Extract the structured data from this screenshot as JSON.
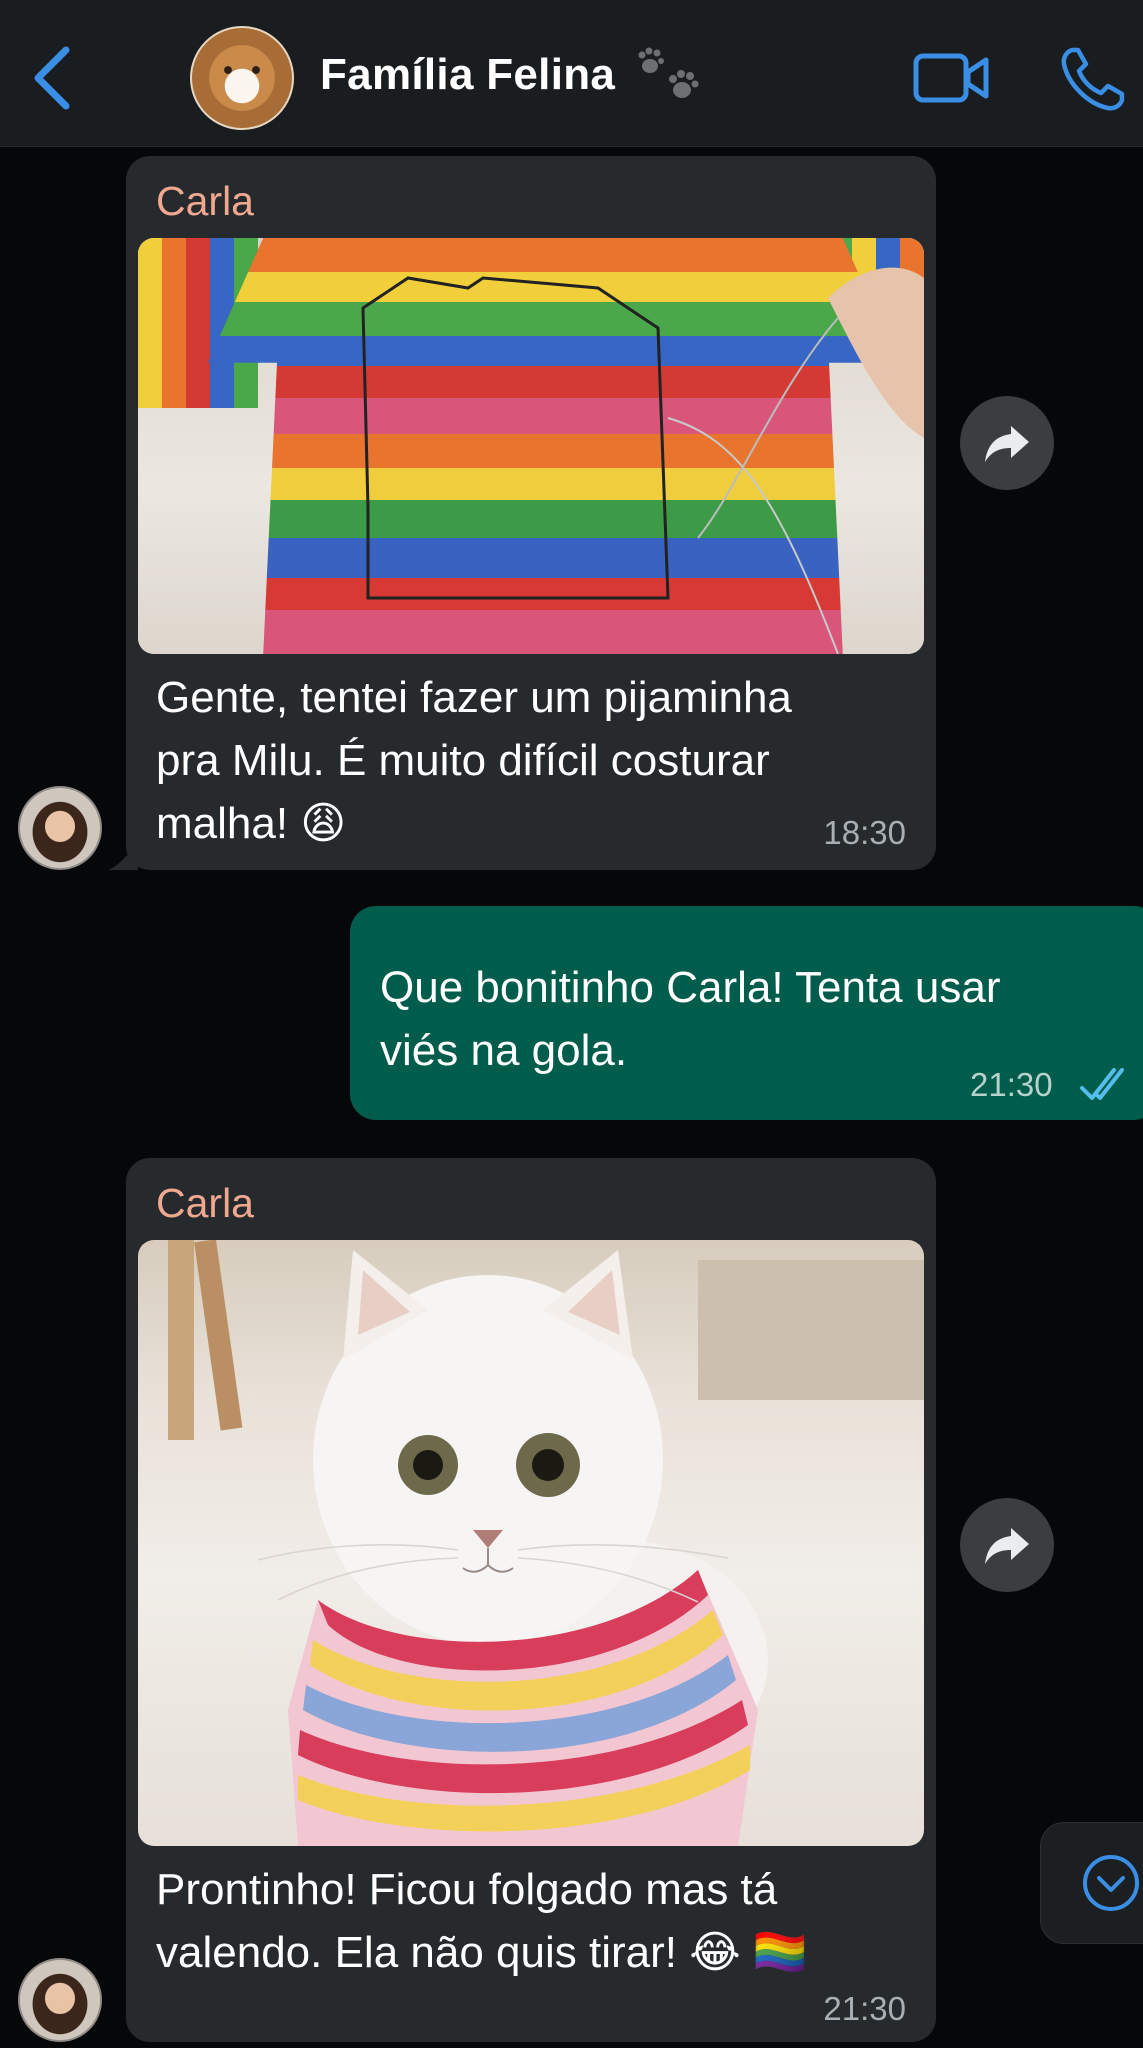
{
  "header": {
    "title": "Família Felina",
    "back_icon": "chevron-left-icon",
    "video_icon": "video-camera-icon",
    "call_icon": "phone-icon",
    "accent_color": "#3a8ee6"
  },
  "messages": [
    {
      "sender": "Carla",
      "text_lines": [
        "Gente, tentei fazer um pijaminha",
        "pra Milu. É muito difícil costurar",
        "malha! 😩"
      ],
      "time": "18:30",
      "direction": "incoming",
      "has_photo": true
    },
    {
      "text_lines": [
        "Que bonitinho Carla! Tenta usar",
        "viés na gola."
      ],
      "time": "21:30",
      "direction": "outgoing",
      "status": "read"
    },
    {
      "sender": "Carla",
      "text_lines": [
        "Prontinho! Ficou folgado mas tá",
        "valendo. Ela não quis tirar! 😂 🏳️‍🌈"
      ],
      "time": "21:30",
      "direction": "incoming",
      "has_photo": true
    }
  ],
  "colors": {
    "incoming_bubble": "#262a2c",
    "outgoing_bubble": "#005c4b",
    "sender_name": "#f0a891",
    "read_ticks": "#53bdeb"
  }
}
